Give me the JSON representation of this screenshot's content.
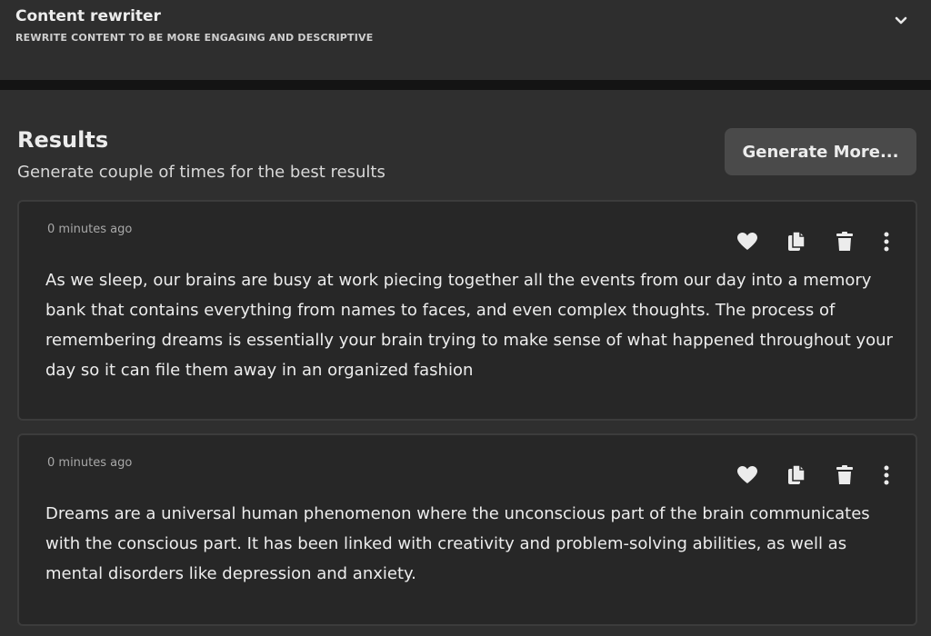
{
  "header": {
    "title": "Content rewriter",
    "subtitle": "REWRITE CONTENT TO BE MORE ENGAGING AND DESCRIPTIVE",
    "collapse_icon": "chevron-down-icon"
  },
  "results": {
    "title": "Results",
    "subtitle": "Generate couple of times for the best results",
    "generate_more_label": "Generate More..."
  },
  "cards": [
    {
      "time": "0 minutes ago",
      "text": "As we sleep, our brains are busy at work piecing together all the events from our day into a memory bank that contains everything from names to faces, and even complex thoughts. The process of remembering dreams is essentially your brain trying to make sense of what happened throughout your day so it can file them away in an organized fashion"
    },
    {
      "time": "0 minutes ago",
      "text": "Dreams are a universal human phenomenon where the unconscious part of the brain communicates with the conscious part. It has been linked with creativity and problem-solving abilities, as well as mental disorders like depression and anxiety."
    }
  ],
  "actions": [
    "heart-icon",
    "copy-icon",
    "trash-icon",
    "more-vertical-icon"
  ],
  "colors": {
    "background": "#2f2f2f",
    "card": "#272727",
    "button": "#4a4a4a",
    "text": "#ececec"
  }
}
